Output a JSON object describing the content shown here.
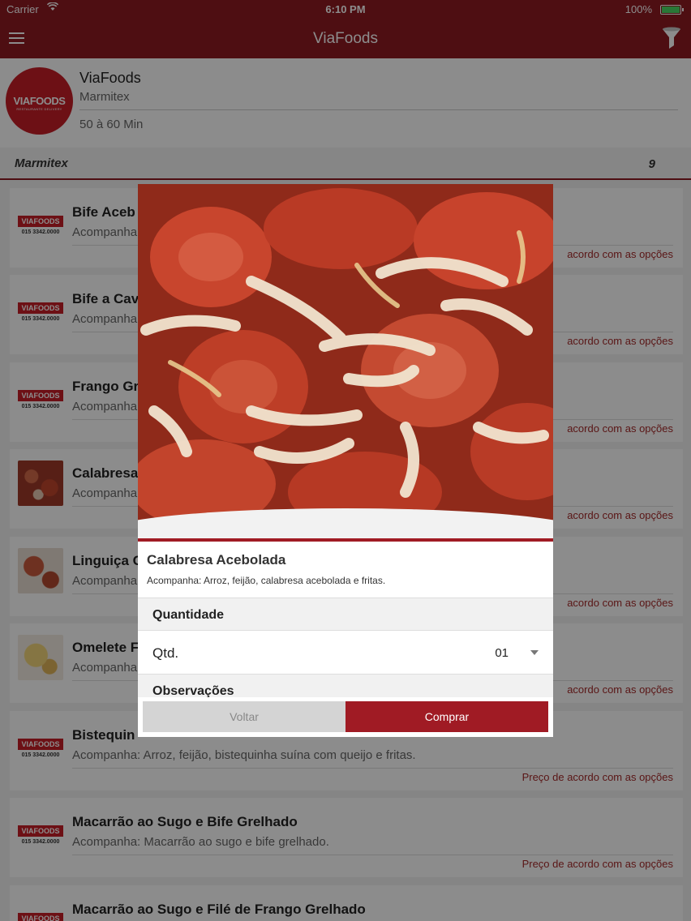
{
  "status_bar": {
    "carrier": "Carrier",
    "time": "6:10 PM",
    "battery": "100%"
  },
  "nav": {
    "title": "ViaFoods",
    "menu_icon": "hamburger-menu-icon",
    "filter_icon": "funnel-filter-icon"
  },
  "restaurant": {
    "logo_text": "VIAFOODS",
    "logo_subtext": "RESTAURANTE DELIVERY",
    "name": "ViaFoods",
    "category": "Marmitex",
    "delivery_time": "50 à 60 Min"
  },
  "section": {
    "name": "Marmitex",
    "count": "9"
  },
  "logo_thumb": {
    "brand": "VIAFOODS",
    "phone": "015 3342.0000"
  },
  "products": [
    {
      "title": "Bife Aceb",
      "desc": "Acompanha",
      "price": "acordo com as opções",
      "thumb": "logo"
    },
    {
      "title": "Bife a Cav",
      "desc": "Acompanha",
      "price": "acordo com as opções",
      "thumb": "logo"
    },
    {
      "title": "Frango Gr",
      "desc": "Acompanha",
      "price": "acordo com as opções",
      "thumb": "logo"
    },
    {
      "title": "Calabresa",
      "desc": "Acompanha",
      "price": "acordo com as opções",
      "thumb": "calabresa"
    },
    {
      "title": "Linguiça C",
      "desc": "Acompanha",
      "price": "acordo com as opções",
      "thumb": "linguica"
    },
    {
      "title": "Omelete F",
      "desc": "Acompanha",
      "price": "acordo com as opções",
      "thumb": "omelete"
    },
    {
      "title": "Bistequin",
      "desc": "Acompanha: Arroz, feijão, bistequinha suína com queijo e fritas.",
      "price": "Preço de acordo com as opções",
      "thumb": "logo"
    },
    {
      "title": "Macarrão ao Sugo e Bife Grelhado",
      "desc": "Acompanha: Macarrão ao sugo e bife grelhado.",
      "price": "Preço de acordo com as opções",
      "thumb": "logo"
    },
    {
      "title": "Macarrão ao Sugo e Filé de Frango Grelhado",
      "desc": "",
      "price": "",
      "thumb": "logo"
    }
  ],
  "modal": {
    "title": "Calabresa Acebolada",
    "desc": "Acompanha: Arroz, feijão, calabresa acebolada e fritas.",
    "section_quantity": "Quantidade",
    "qty_label": "Qtd.",
    "qty_value": "01",
    "section_notes": "Observações",
    "btn_back": "Voltar",
    "btn_buy": "Comprar",
    "accent_color": "#a01b24"
  }
}
